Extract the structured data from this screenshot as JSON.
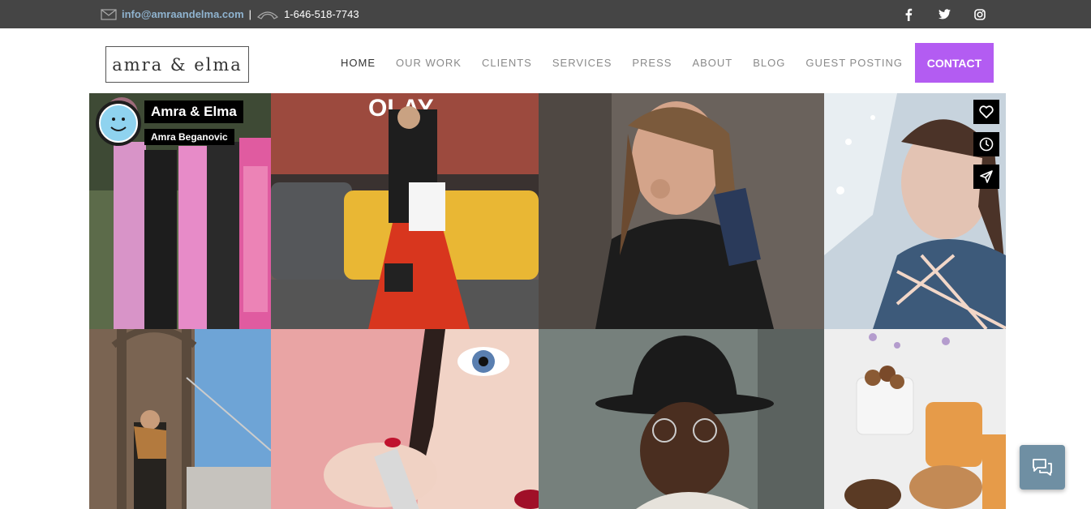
{
  "topbar": {
    "email": "info@amraandelma.com",
    "separator": "|",
    "phone": "1-646-518-7743",
    "icons": [
      "mail-icon",
      "phone-icon"
    ],
    "social": [
      "facebook-icon",
      "twitter-icon",
      "instagram-icon"
    ]
  },
  "header": {
    "logo": "amra & elma",
    "nav": [
      {
        "label": "HOME",
        "active": true
      },
      {
        "label": "OUR WORK"
      },
      {
        "label": "CLIENTS"
      },
      {
        "label": "SERVICES"
      },
      {
        "label": "PRESS"
      },
      {
        "label": "ABOUT"
      },
      {
        "label": "BLOG"
      },
      {
        "label": "GUEST POSTING"
      }
    ],
    "contact": "CONTACT"
  },
  "profile": {
    "name": "Amra & Elma",
    "subtitle": "Amra Beganovic"
  },
  "actions": [
    "heart-icon",
    "clock-icon",
    "send-icon"
  ],
  "chat": "chat-icon"
}
